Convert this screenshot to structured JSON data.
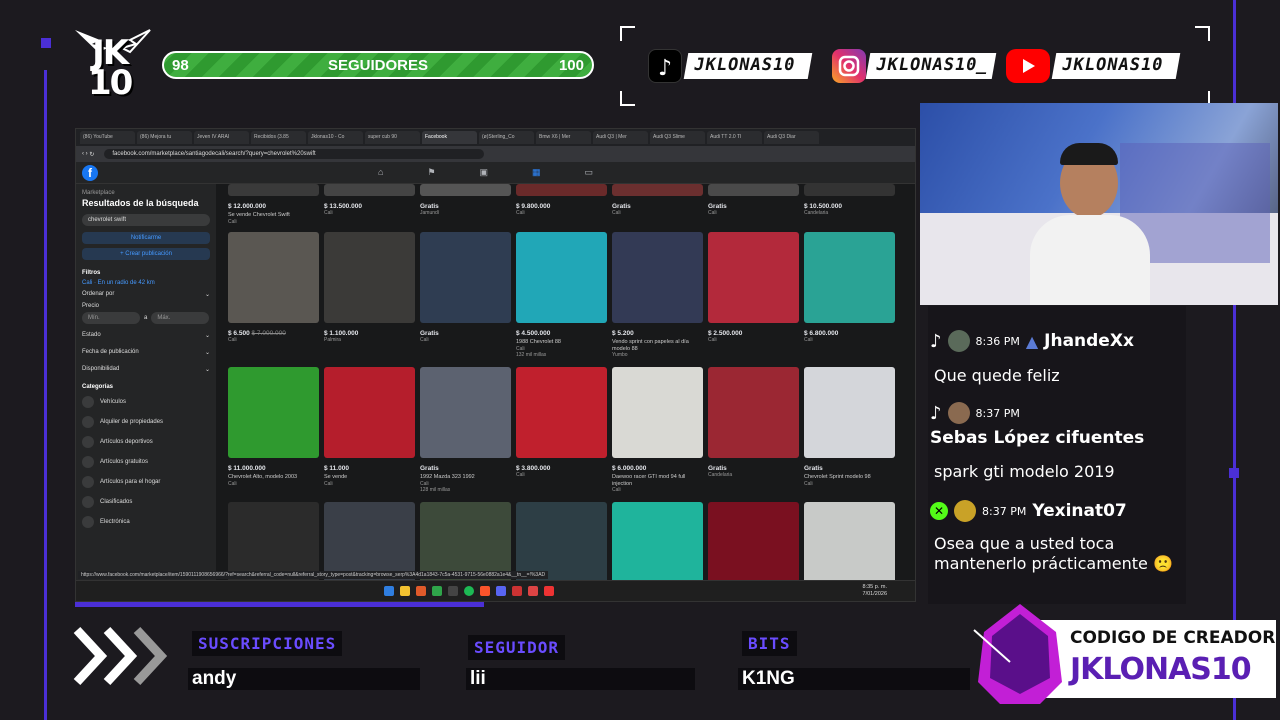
{
  "overlay": {
    "logo_text": "JK\n10",
    "progress": {
      "min": "98",
      "label": "SEGUIDORES",
      "max": "100",
      "fraction": 0.98
    },
    "socials": [
      {
        "icon": "tiktok-icon",
        "handle": "JKLONAS10",
        "color": "#000000"
      },
      {
        "icon": "instagram-icon",
        "handle": "JKLONAS10_",
        "color": "#c13584"
      },
      {
        "icon": "youtube-icon",
        "handle": "JKLONAS10",
        "color": "#ff0000"
      }
    ],
    "accent": "#4b2fd6"
  },
  "browser": {
    "tabs": [
      "(86) YouTube",
      "(86) Mejora tu",
      "Jeven IV ARAI",
      "Recibidos (3.85",
      "Jklonas10 - Co",
      "super cub 90",
      "Facebook",
      "(ø)Sterling_Co",
      "Bmw X6 | Mer",
      "Audi Q3 | Mer",
      "Audi Q3 Slime",
      "Audi TT 2.0 TI",
      "Audi Q3 Diar"
    ],
    "active_tab": 6,
    "url": "facebook.com/marketplace/santiagodecali/search/?query=chevrolet%20swift",
    "status_url": "https://www.facebook.com/marketplace/item/1590111908656966/?ref=search&referral_code=null&referral_story_type=post&tracking=browse_serp%3A4d1a1843-7c5a-4531-9715-56e0882a1e4&__tn__=!%3AD",
    "clock": {
      "time": "8:35 p. m.",
      "date": "7/01/2026"
    }
  },
  "sidebar": {
    "section": "Marketplace",
    "title": "Resultados de la búsqueda",
    "search_value": "chevrolet swift",
    "notify_btn": "Notificarme",
    "create_btn": "+ Crear publicación",
    "filters_title": "Filtros",
    "location": "Cali · En un radio de 42 km",
    "sort": "Ordenar por",
    "price_label": "Precio",
    "min_placeholder": "Mín.",
    "max_placeholder": "Máx.",
    "price_sep": "a",
    "state": "Estado",
    "pub_date": "Fecha de publicación",
    "availability": "Disponibilidad",
    "categories_title": "Categorías",
    "categories": [
      "Vehículos",
      "Alquiler de propiedades",
      "Artículos deportivos",
      "Artículos gratuitos",
      "Artículos para el hogar",
      "Clasificados",
      "Electrónica"
    ]
  },
  "listings_top": [
    {
      "price": "$ 12.000.000",
      "title": "Se vende Chevrolet Swift",
      "loc": "Cali"
    },
    {
      "price": "$ 13.500.000",
      "title": "",
      "loc": "Cali"
    },
    {
      "price": "Gratis",
      "title": "",
      "loc": "Jamundí"
    },
    {
      "price": "$ 9.800.000",
      "title": "",
      "loc": "Cali"
    },
    {
      "price": "Gratis",
      "title": "",
      "loc": "Cali"
    },
    {
      "price": "Gratis",
      "title": "",
      "loc": "Cali"
    },
    {
      "price": "$ 10.500.000",
      "title": "",
      "loc": "Candelaria"
    }
  ],
  "listings_row2": [
    {
      "price": "$ 6.500",
      "old": "$ 7.000.000",
      "title": "",
      "loc": "Cali",
      "color": "#5a5752"
    },
    {
      "price": "$ 1.100.000",
      "old": "",
      "title": "",
      "loc": "Palmira",
      "color": "#3b3a38"
    },
    {
      "price": "Gratis",
      "old": "",
      "title": "",
      "loc": "Cali",
      "color": "#2f3d52"
    },
    {
      "price": "$ 4.500.000",
      "old": "",
      "title": "1988 Chevrolet 88",
      "loc": "Cali",
      "extra": "132 mil millas",
      "color": "#21a7b7"
    },
    {
      "price": "$ 5.200",
      "old": "",
      "title": "Vendo sprint con papeles al día modelo 88",
      "loc": "Yumbo",
      "color": "#333a55"
    },
    {
      "price": "$ 2.500.000",
      "old": "",
      "title": "",
      "loc": "Cali",
      "color": "#b3293b"
    },
    {
      "price": "$ 6.800.000",
      "old": "",
      "title": "",
      "loc": "Cali",
      "color": "#2aa395"
    }
  ],
  "listings_row3": [
    {
      "price": "$ 11.000.000",
      "title": "Chevrolet Alto, modelo 2003",
      "loc": "Cali",
      "color": "#2f9a2f"
    },
    {
      "price": "$ 11.000",
      "title": "Se vende",
      "loc": "Cali",
      "color": "#b51e2c"
    },
    {
      "price": "Gratis",
      "title": "1992 Mazda 323 1992",
      "loc": "Cali",
      "extra": "128 mil millas",
      "color": "#5c6270"
    },
    {
      "price": "$ 3.800.000",
      "title": "",
      "loc": "Cali",
      "color": "#c0202d"
    },
    {
      "price": "$ 6.000.000",
      "title": "Daewoo racer GTI mod 94 full injection",
      "loc": "Cali",
      "color": "#d9d9d4"
    },
    {
      "price": "Gratis",
      "title": "",
      "loc": "Candelaria",
      "color": "#9b2733"
    },
    {
      "price": "Gratis",
      "title": "Chevrolet Sprint modelo 98",
      "loc": "Cali",
      "color": "#d4d6da"
    }
  ],
  "listings_row4": [
    {
      "color": "#2b2b2b"
    },
    {
      "color": "#3a3f48"
    },
    {
      "color": "#3d4a3a"
    },
    {
      "color": "#2d3e45"
    },
    {
      "color": "#1fb49c"
    },
    {
      "color": "#7a1020"
    },
    {
      "color": "#c8cac8"
    }
  ],
  "chat": {
    "messages": [
      {
        "time": "8:36 PM",
        "user": "JhandeXx",
        "text": "Que quede feliz"
      },
      {
        "time": "8:37 PM",
        "user": "Sebas López cifuentes",
        "text": "spark gti modelo 2019"
      },
      {
        "time": "8:37 PM",
        "user": "Yexinat07",
        "text": "Osea que a usted toca mantenerlo prácticamente 🙁"
      }
    ]
  },
  "bottom": {
    "subs_label": "SUSCRIPCIONES",
    "subs_value": "andy",
    "follower_label": "SEGUIDOR",
    "follower_value": "lii",
    "bits_label": "BITS",
    "bits_value": "K1NG",
    "code_title": "CODIGO DE CREADOR",
    "code_name": "JKLONAS10"
  }
}
